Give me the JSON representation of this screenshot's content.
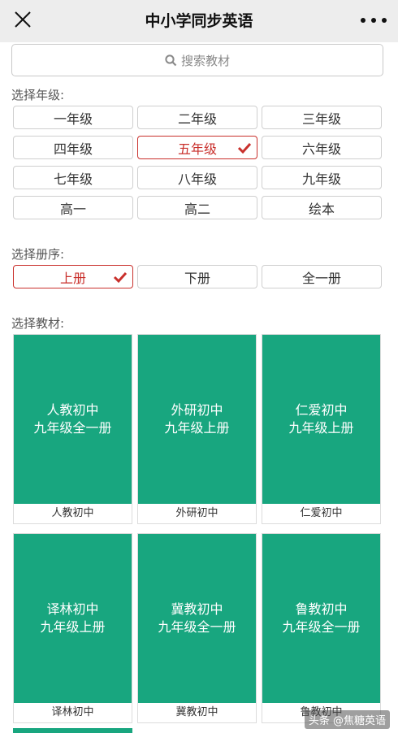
{
  "header": {
    "title": "中小学同步英语",
    "close_icon": "close-icon",
    "more_icon": "more-dots-icon"
  },
  "search": {
    "placeholder": "搜索教材",
    "icon": "search-icon"
  },
  "grade_section": {
    "label": "选择年级:",
    "options": [
      {
        "label": "一年级",
        "selected": false
      },
      {
        "label": "二年级",
        "selected": false
      },
      {
        "label": "三年级",
        "selected": false
      },
      {
        "label": "四年级",
        "selected": false
      },
      {
        "label": "五年级",
        "selected": false
      },
      {
        "label": "六年级",
        "selected": false
      },
      {
        "label": "七年级",
        "selected": false
      },
      {
        "label": "八年级",
        "selected": false
      },
      {
        "label": "九年级",
        "selected": true
      },
      {
        "label": "高一",
        "selected": false
      },
      {
        "label": "高二",
        "selected": false
      },
      {
        "label": "绘本",
        "selected": false
      }
    ]
  },
  "volume_section": {
    "label": "选择册序:",
    "options": [
      {
        "label": "上册",
        "selected": true
      },
      {
        "label": "下册",
        "selected": false
      },
      {
        "label": "全一册",
        "selected": false
      }
    ]
  },
  "textbook_section": {
    "label": "选择教材:",
    "books": [
      {
        "cover_line1": "人教初中",
        "cover_line2": "九年级全一册",
        "name": "人教初中"
      },
      {
        "cover_line1": "外研初中",
        "cover_line2": "九年级上册",
        "name": "外研初中"
      },
      {
        "cover_line1": "仁爱初中",
        "cover_line2": "九年级上册",
        "name": "仁爱初中"
      },
      {
        "cover_line1": "译林初中",
        "cover_line2": "九年级上册",
        "name": "译林初中"
      },
      {
        "cover_line1": "冀教初中",
        "cover_line2": "九年级全一册",
        "name": "冀教初中"
      },
      {
        "cover_line1": "鲁教初中",
        "cover_line2": "九年级全一册",
        "name": "鲁教初中"
      }
    ]
  },
  "watermark": "头条 @焦糖英语",
  "colors": {
    "accent_red": "#c9302c",
    "cover_green": "#18a67f",
    "header_bg": "#ededed"
  }
}
